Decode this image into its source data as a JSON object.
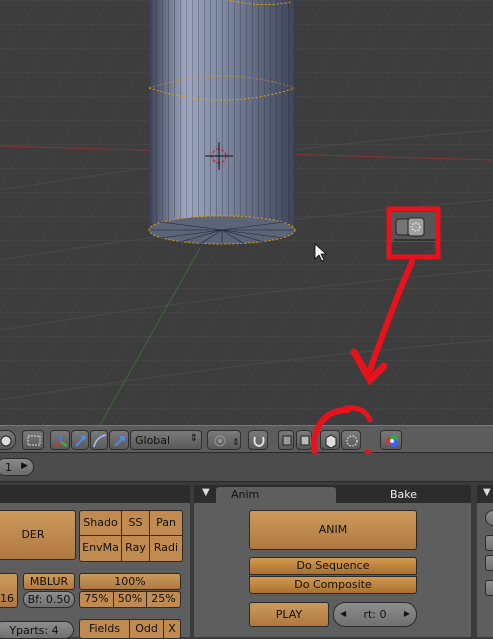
{
  "toolbar": {
    "transform_orientation": "Global"
  },
  "framebar": {
    "frame_value": "1"
  },
  "render_panel": {
    "render_label": "DER",
    "toggles_row1": [
      "Shado",
      "SS",
      "Pan"
    ],
    "toggles_row2": [
      "EnvMa",
      "Ray",
      "Radi"
    ],
    "mblur_label": "MBLUR",
    "mblur_frames": "16",
    "bf_field": "Bf: 0.50",
    "percent_full": "100%",
    "percent_options": [
      "75%",
      "50%",
      "25%"
    ],
    "yparts_field": "Yparts: 4",
    "field_options": [
      "Fields",
      "Odd",
      "X"
    ]
  },
  "anim_panel": {
    "tabs": [
      "Anim",
      "Bake"
    ],
    "anim_label": "ANIM",
    "do_sequence_label": "Do Sequence",
    "do_composite_label": "Do Composite",
    "play_label": "PLAY",
    "rt_field": "rt: 0"
  },
  "colors": {
    "annotation_red": "#e8121c",
    "button_orange": "#c08a50",
    "vertex_orange": "#ffaa00",
    "panel_grey": "#5e5e5e"
  },
  "icons": [
    "rotation-manipulator-icon",
    "scale-manipulator-icon",
    "pivot-icon",
    "orientation-arrows-icon",
    "snap-icon",
    "layer-icon",
    "occlude-background-icon",
    "render-preview-icon",
    "proportional-edit-icon"
  ]
}
